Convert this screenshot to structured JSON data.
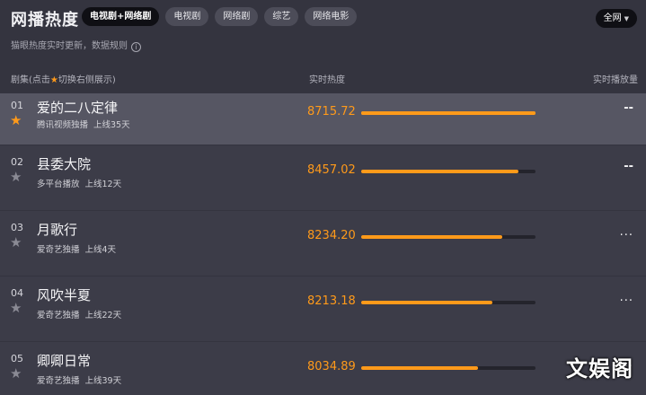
{
  "header": {
    "title": "网播热度",
    "tabs": [
      {
        "label": "电视剧+网络剧",
        "active": true
      },
      {
        "label": "电视剧",
        "active": false
      },
      {
        "label": "网络剧",
        "active": false
      },
      {
        "label": "综艺",
        "active": false
      },
      {
        "label": "网络电影",
        "active": false
      }
    ],
    "region_label": "全网",
    "subtitle": "猫眼热度实时更新，数据规则",
    "info_icon": "i"
  },
  "columns": {
    "show_prefix": "剧集(点击",
    "show_suffix": "切换右侧展示)",
    "heat": "实时热度",
    "play": "实时播放量"
  },
  "rows": [
    {
      "rank": "01",
      "name": "爱的二八定律",
      "platform": "腾讯视频独播",
      "days": "上线35天",
      "heat": "8715.72",
      "heat_fraction": 1.0,
      "play": "--",
      "starred": true
    },
    {
      "rank": "02",
      "name": "县委大院",
      "platform": "多平台播放",
      "days": "上线12天",
      "heat": "8457.02",
      "heat_fraction": 0.9,
      "play": "--",
      "starred": false
    },
    {
      "rank": "03",
      "name": "月歌行",
      "platform": "爱奇艺独播",
      "days": "上线4天",
      "heat": "8234.20",
      "heat_fraction": 0.81,
      "play": "...",
      "starred": false
    },
    {
      "rank": "04",
      "name": "风吹半夏",
      "platform": "爱奇艺独播",
      "days": "上线22天",
      "heat": "8213.18",
      "heat_fraction": 0.75,
      "play": "...",
      "starred": false
    },
    {
      "rank": "05",
      "name": "卿卿日常",
      "platform": "爱奇艺独播",
      "days": "上线39天",
      "heat": "8034.89",
      "heat_fraction": 0.67,
      "play": "...",
      "starred": false
    }
  ],
  "watermark": "文娱阁",
  "colors": {
    "accent": "#ff9a1a",
    "background": "#3a3a46",
    "highlight_row": "#565663"
  },
  "icons": {
    "star": "★"
  }
}
